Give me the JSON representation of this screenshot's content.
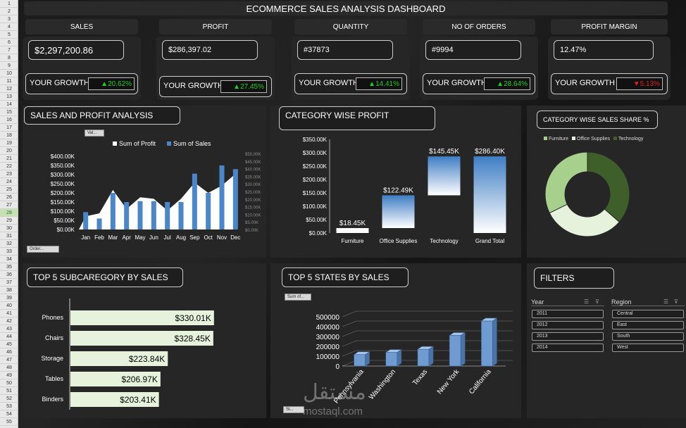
{
  "dashboard_title": "ECOMMERCE SALES ANALYSIS DASHBOARD",
  "row_numbers": [
    "1",
    "2",
    "3",
    "4",
    "5",
    "6",
    "7",
    "8",
    "9",
    "10",
    "11",
    "12",
    "13",
    "14",
    "15",
    "16",
    "17",
    "18",
    "19",
    "20",
    "21",
    "22",
    "23",
    "24",
    "25",
    "26",
    "27",
    "28",
    "29",
    "30",
    "31",
    "32",
    "33",
    "34",
    "35",
    "36",
    "37",
    "38",
    "39",
    "40",
    "41",
    "42",
    "43",
    "44",
    "45",
    "46",
    "47",
    "48",
    "49",
    "50",
    "51",
    "52",
    "53",
    "54",
    "55"
  ],
  "kpis": [
    {
      "header": "SALES",
      "value": "$2,297,200.86",
      "growth_label": "YOUR GROWTH",
      "growth": "20.62%",
      "dir": "up",
      "arrow": "▲"
    },
    {
      "header": "PROFIT",
      "value": "$286,397.02",
      "growth_label": "YOUR GROWTH",
      "growth": "27.45%",
      "dir": "up",
      "arrow": "▲"
    },
    {
      "header": "QUANTITY",
      "value": "#37873",
      "growth_label": "YOUR GROWTH",
      "growth": "14.41%",
      "dir": "up",
      "arrow": "▲"
    },
    {
      "header": "NO OF ORDERS",
      "value": "#9994",
      "growth_label": "YOUR GROWTH",
      "growth": "28.64%",
      "dir": "up",
      "arrow": "▲"
    },
    {
      "header": "PROFIT MARGIN",
      "value": "12.47%",
      "growth_label": "YOUR GROWTH",
      "growth": "5.13%",
      "dir": "down",
      "arrow": "▼"
    }
  ],
  "colors": {
    "up": "#22cc22",
    "down": "#e02020",
    "bar_blue": "#4a86c8",
    "light_green": "#e6f2dc",
    "dark_green": "#3e5e2a",
    "mid_green": "#a8d08d"
  },
  "sales_profit": {
    "title": "SALES AND PROFIT ANALYSIS",
    "filter_btn": "Val...",
    "axis_btn": "Order...",
    "legend_profit": "Sum of Profit",
    "legend_sales": "Sum of Sales",
    "left_ticks": [
      "$400.00K",
      "$350.00K",
      "$300.00K",
      "$250.00K",
      "$200.00K",
      "$150.00K",
      "$100.00K",
      "$50.00K",
      "$0.00K"
    ],
    "right_ticks": [
      "$50.00K",
      "$45.00K",
      "$40.00K",
      "$35.00K",
      "$30.00K",
      "$25.00K",
      "$20.00K",
      "$15.00K",
      "$10.00K",
      "$5.00K",
      "$0.00K"
    ],
    "chart_data": {
      "type": "bar",
      "categories": [
        "Jan",
        "Feb",
        "Mar",
        "Apr",
        "May",
        "Jun",
        "Jul",
        "Aug",
        "Sep",
        "Oct",
        "Nov",
        "Dec"
      ],
      "series": [
        {
          "name": "Sum of Sales",
          "values": [
            95,
            60,
            200,
            150,
            155,
            155,
            150,
            150,
            305,
            200,
            350,
            330
          ]
        },
        {
          "name": "Sum of Profit",
          "values": [
            9,
            11,
            27,
            14,
            22,
            21,
            13,
            21,
            32,
            25,
            30,
            38
          ]
        }
      ],
      "ylim_left": [
        0,
        400
      ],
      "ylim_right": [
        0,
        50
      ]
    }
  },
  "category_profit": {
    "title": "CATEGORY WISE PROFIT",
    "ticks": [
      "$350.00K",
      "$300.00K",
      "$250.00K",
      "$200.00K",
      "$150.00K",
      "$100.00K",
      "$50.00K",
      "$0.00K"
    ],
    "chart_data": {
      "type": "bar",
      "categories": [
        "Furniture",
        "Office Supplies",
        "Technology",
        "Grand Total"
      ],
      "values": [
        18.45,
        122.49,
        145.45,
        286.4
      ],
      "labels": [
        "$18.45K",
        "$122.49K",
        "$145.45K",
        "$286.40K"
      ],
      "ylim": [
        0,
        350
      ]
    }
  },
  "category_share": {
    "title": "CATEGORY WISE SALES SHARE %",
    "chart_data": {
      "type": "pie",
      "categories": [
        "Furniture",
        "Office Supplies",
        "Technology"
      ],
      "values": [
        32.3,
        31.3,
        36.4
      ]
    }
  },
  "top_subcategory": {
    "title": "TOP 5 SUBCAREGORY BY SALES",
    "chart_data": {
      "type": "bar",
      "categories": [
        "Phones",
        "Chairs",
        "Storage",
        "Tables",
        "Binders"
      ],
      "values": [
        330.01,
        328.45,
        223.84,
        206.97,
        203.41
      ],
      "labels": [
        "$330.01K",
        "$328.45K",
        "$223.84K",
        "$206.97K",
        "$203.41K"
      ]
    }
  },
  "top_states": {
    "title": "TOP 5 STATES BY SALES",
    "filter_btn": "Sum of...",
    "axis_btn": "St...",
    "ticks": [
      "500000",
      "400000",
      "300000",
      "200000",
      "100000",
      "0"
    ],
    "chart_data": {
      "type": "bar",
      "categories": [
        "Pennsylvania",
        "Washington",
        "Texas",
        "New York",
        "California"
      ],
      "values": [
        116512,
        138641,
        170188,
        310876,
        457688
      ],
      "ylim": [
        0,
        500000
      ]
    }
  },
  "filters": {
    "title": "FILTERS",
    "year_label": "Year",
    "years": [
      "2011",
      "2012",
      "2013",
      "2014"
    ],
    "region_label": "Region",
    "regions": [
      "Central",
      "East",
      "South",
      "West"
    ]
  },
  "watermark": {
    "arabic": "مستقل",
    "latin": "mostaql.com"
  }
}
